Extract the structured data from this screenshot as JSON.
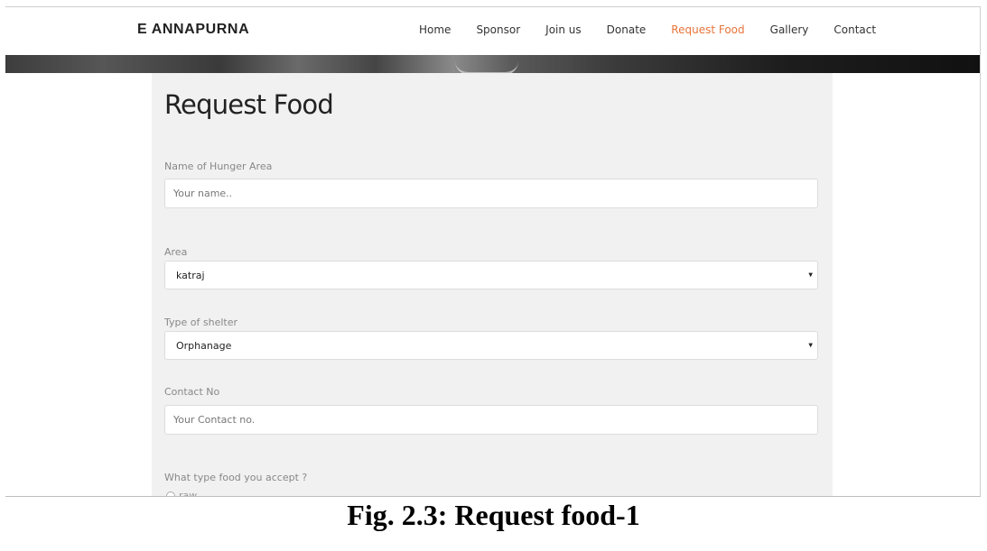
{
  "brand": "E ANNAPURNA",
  "nav": {
    "items": [
      {
        "label": "Home"
      },
      {
        "label": "Sponsor"
      },
      {
        "label": "Join us"
      },
      {
        "label": "Donate"
      },
      {
        "label": "Request Food",
        "active": true
      },
      {
        "label": "Gallery"
      },
      {
        "label": "Contact"
      }
    ],
    "active_color": "#e8743b"
  },
  "form": {
    "title": "Request Food",
    "hunger_area": {
      "label": "Name of Hunger Area",
      "placeholder": "Your name.."
    },
    "area": {
      "label": "Area",
      "value": "katraj"
    },
    "shelter": {
      "label": "Type of shelter",
      "value": "Orphanage"
    },
    "contact": {
      "label": "Contact No",
      "placeholder": "Your Contact no."
    },
    "food_type": {
      "label": "What type food you accept ?",
      "options": [
        "raw"
      ]
    }
  },
  "caption": "Fig. 2.3: Request food-1"
}
